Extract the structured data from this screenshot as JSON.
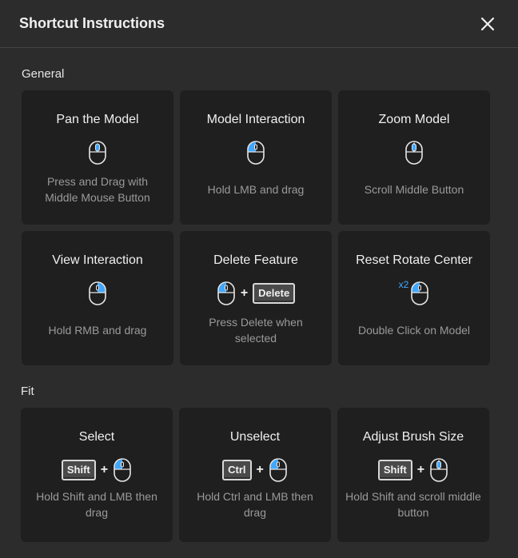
{
  "dialog": {
    "title": "Shortcut Instructions"
  },
  "sections": {
    "general": "General",
    "fit": "Fit"
  },
  "cards": {
    "pan": {
      "title": "Pan the Model",
      "desc": "Press and Drag with Middle Mouse Button"
    },
    "model_interaction": {
      "title": "Model Interaction",
      "desc": "Hold LMB and drag"
    },
    "zoom": {
      "title": "Zoom Model",
      "desc": "Scroll Middle Button"
    },
    "view_interaction": {
      "title": "View Interaction",
      "desc": "Hold RMB and drag"
    },
    "delete_feature": {
      "title": "Delete Feature",
      "key": "Delete",
      "desc": "Press Delete when selected"
    },
    "reset_rotate": {
      "title": "Reset Rotate Center",
      "badge": "x2",
      "desc": "Double Click on Model"
    },
    "select": {
      "title": "Select",
      "key": "Shift",
      "desc": "Hold Shift and LMB then drag"
    },
    "unselect": {
      "title": "Unselect",
      "key": "Ctrl",
      "desc": "Hold Ctrl and LMB then drag"
    },
    "brush_size": {
      "title": "Adjust Brush Size",
      "key": "Shift",
      "desc": "Hold Shift and scroll middle button"
    }
  },
  "plus_sign": "+",
  "colors": {
    "accent": "#3fa7ff",
    "card_bg": "#1f1f1f",
    "dialog_bg": "#2c2c2c",
    "muted_text": "#9a9a9a"
  }
}
